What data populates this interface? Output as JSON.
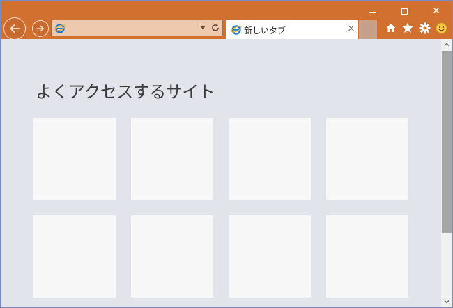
{
  "window": {
    "controls": [
      "minimize",
      "maximize",
      "close"
    ],
    "close_glyph": "✕",
    "frame_color": "#d2712f"
  },
  "address_bar": {
    "value": "",
    "placeholder": "",
    "icon": "ie-logo-icon"
  },
  "tab": {
    "title": "新しいタブ",
    "close_glyph": "×",
    "icon": "ie-logo-icon"
  },
  "toolbar": {
    "icons": [
      "home-icon",
      "favorites-star-icon",
      "settings-gear-icon",
      "feedback-smiley-icon"
    ]
  },
  "content": {
    "heading": "よくアクセスするサイト",
    "tiles": [
      {
        "label": ""
      },
      {
        "label": ""
      },
      {
        "label": ""
      },
      {
        "label": ""
      },
      {
        "label": ""
      },
      {
        "label": ""
      },
      {
        "label": ""
      },
      {
        "label": ""
      }
    ]
  },
  "colors": {
    "accent": "#d2712f",
    "content_bg": "#e2e4ec",
    "tile_bg": "#f7f7f7",
    "scroll_thumb": "#a6a6a6"
  }
}
